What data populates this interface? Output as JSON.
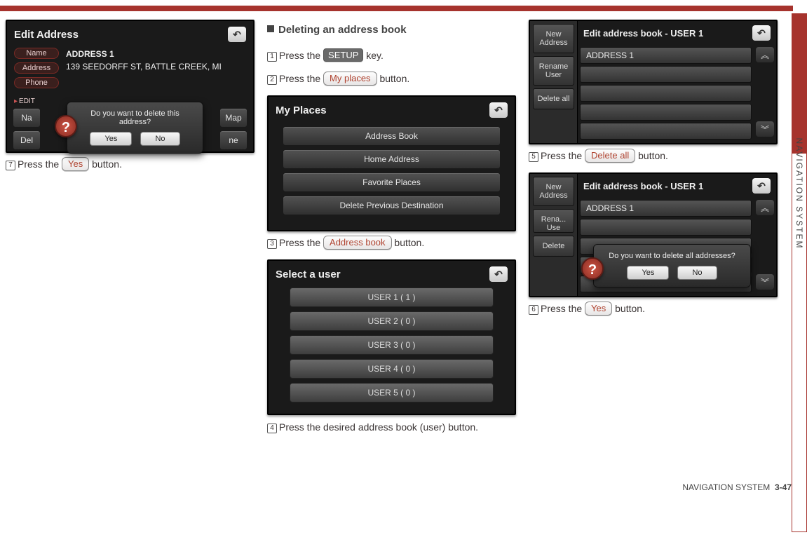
{
  "meta": {
    "section_side": "NAVIGATION SYSTEM",
    "footer_section": "NAVIGATION SYSTEM",
    "page_no": "3-47"
  },
  "col1": {
    "shot1": {
      "title": "Edit Address",
      "pills": [
        "Name",
        "Address",
        "Phone"
      ],
      "addr_name": "ADDRESS 1",
      "addr_line": "139 SEEDORFF ST, BATTLE CREEK, MI",
      "edit_label": "EDIT",
      "partial_left": [
        "Na",
        "Del"
      ],
      "partial_right": [
        "Map",
        "ne"
      ],
      "dlg_msg": "Do you want to delete this address?",
      "dlg_yes": "Yes",
      "dlg_no": "No"
    },
    "step7": {
      "n": "7",
      "pre": "Press the ",
      "btn": "Yes",
      "post": " button."
    }
  },
  "col2": {
    "heading": "Deleting an address book",
    "step1": {
      "n": "1",
      "pre": "Press the ",
      "btn": "SETUP",
      "post": " key."
    },
    "step2": {
      "n": "2",
      "pre": "Press the ",
      "btn": "My places",
      "post": " button."
    },
    "shot2": {
      "title": "My Places",
      "items": [
        "Address Book",
        "Home Address",
        "Favorite Places",
        "Delete Previous Destination"
      ]
    },
    "step3": {
      "n": "3",
      "pre": "Press the ",
      "btn": "Address book",
      "post": " button."
    },
    "shot3": {
      "title": "Select a user",
      "users": [
        "USER 1 ( 1 )",
        "USER 2 ( 0 )",
        "USER 3 ( 0 )",
        "USER 4 ( 0 )",
        "USER 5 ( 0 )"
      ]
    },
    "step4": {
      "n": "4",
      "text": "Press the desired address book (user) button."
    }
  },
  "col3": {
    "shot4": {
      "title": "Edit address book - USER 1",
      "side": [
        "New Address",
        "Rename User",
        "Delete all"
      ],
      "rows": [
        "ADDRESS 1",
        "",
        "",
        "",
        ""
      ]
    },
    "step5": {
      "n": "5",
      "pre": "Press the ",
      "btn": "Delete all",
      "post": " button."
    },
    "shot5": {
      "title": "Edit address book - USER 1",
      "side": [
        "New Address",
        "Rena... Use",
        "Delete"
      ],
      "row0": "ADDRESS 1",
      "dlg_msg": "Do you want to delete all addresses?",
      "dlg_yes": "Yes",
      "dlg_no": "No"
    },
    "step6": {
      "n": "6",
      "pre": "Press the ",
      "btn": "Yes",
      "post": " button."
    }
  }
}
